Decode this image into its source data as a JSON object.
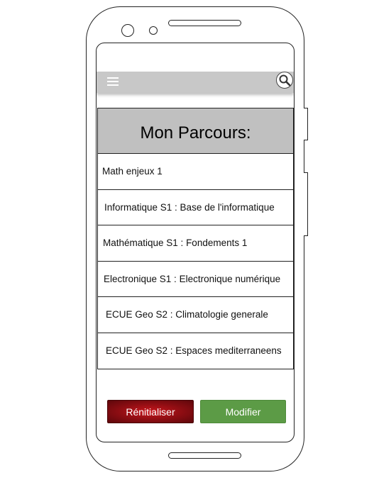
{
  "app": {
    "menu_icon": "hamburger-icon",
    "search_icon": "search-icon"
  },
  "panel": {
    "title": "Mon Parcours:",
    "courses": [
      {
        "label": "Math enjeux 1"
      },
      {
        "label": "Informatique S1 : Base de l'informatique"
      },
      {
        "label": "Mathématique S1 : Fondements 1"
      },
      {
        "label": "Electronique S1 : Electronique numérique"
      },
      {
        "label": "ECUE Geo S2 : Climatologie generale"
      },
      {
        "label": "ECUE Geo S2 : Espaces mediterraneens"
      }
    ]
  },
  "actions": {
    "reset_label": "Rénitialiser",
    "edit_label": "Modifier"
  },
  "colors": {
    "appbar": "#c8c8c8",
    "header": "#c0c0c0",
    "reset_button": "#8b0d12",
    "edit_button": "#5c9b46"
  }
}
